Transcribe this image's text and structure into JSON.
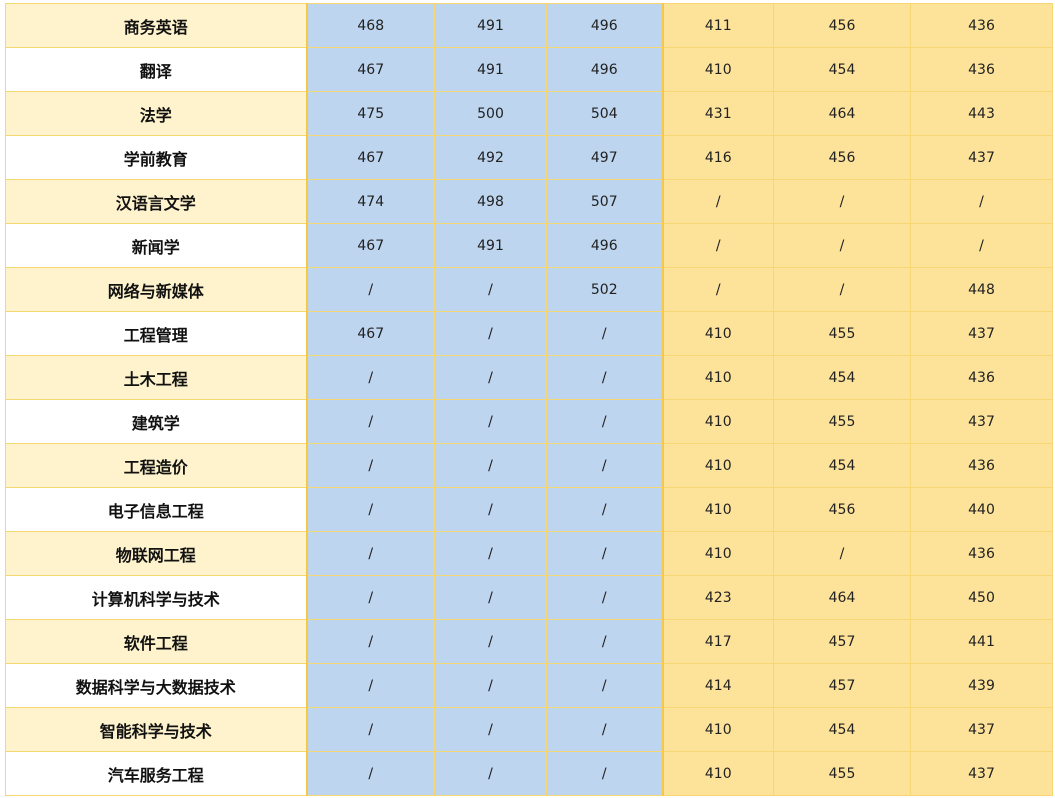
{
  "table": {
    "rows": [
      {
        "name": "商务英语",
        "scores": [
          "468",
          "491",
          "496",
          "411",
          "456",
          "436"
        ]
      },
      {
        "name": "翻译",
        "scores": [
          "467",
          "491",
          "496",
          "410",
          "454",
          "436"
        ]
      },
      {
        "name": "法学",
        "scores": [
          "475",
          "500",
          "504",
          "431",
          "464",
          "443"
        ]
      },
      {
        "name": "学前教育",
        "scores": [
          "467",
          "492",
          "497",
          "416",
          "456",
          "437"
        ]
      },
      {
        "name": "汉语言文学",
        "scores": [
          "474",
          "498",
          "507",
          "/",
          "/",
          "/"
        ]
      },
      {
        "name": "新闻学",
        "scores": [
          "467",
          "491",
          "496",
          "/",
          "/",
          "/"
        ]
      },
      {
        "name": "网络与新媒体",
        "scores": [
          "/",
          "/",
          "502",
          "/",
          "/",
          "448"
        ]
      },
      {
        "name": "工程管理",
        "scores": [
          "467",
          "/",
          "/",
          "410",
          "455",
          "437"
        ]
      },
      {
        "name": "土木工程",
        "scores": [
          "/",
          "/",
          "/",
          "410",
          "454",
          "436"
        ]
      },
      {
        "name": "建筑学",
        "scores": [
          "/",
          "/",
          "/",
          "410",
          "455",
          "437"
        ]
      },
      {
        "name": "工程造价",
        "scores": [
          "/",
          "/",
          "/",
          "410",
          "454",
          "436"
        ]
      },
      {
        "name": "电子信息工程",
        "scores": [
          "/",
          "/",
          "/",
          "410",
          "456",
          "440"
        ]
      },
      {
        "name": "物联网工程",
        "scores": [
          "/",
          "/",
          "/",
          "410",
          "/",
          "436"
        ]
      },
      {
        "name": "计算机科学与技术",
        "scores": [
          "/",
          "/",
          "/",
          "423",
          "464",
          "450"
        ]
      },
      {
        "name": "软件工程",
        "scores": [
          "/",
          "/",
          "/",
          "417",
          "457",
          "441"
        ]
      },
      {
        "name": "数据科学与大数据技术",
        "scores": [
          "/",
          "/",
          "/",
          "414",
          "457",
          "439"
        ]
      },
      {
        "name": "智能科学与技术",
        "scores": [
          "/",
          "/",
          "/",
          "410",
          "454",
          "437"
        ]
      },
      {
        "name": "汽车服务工程",
        "scores": [
          "/",
          "/",
          "/",
          "410",
          "455",
          "437"
        ]
      }
    ]
  },
  "colors": {
    "blue_group": "#bdd5ee",
    "yellow_group": "#fde29a",
    "name_alt": "#fef3cc",
    "border": "#f7d774"
  }
}
